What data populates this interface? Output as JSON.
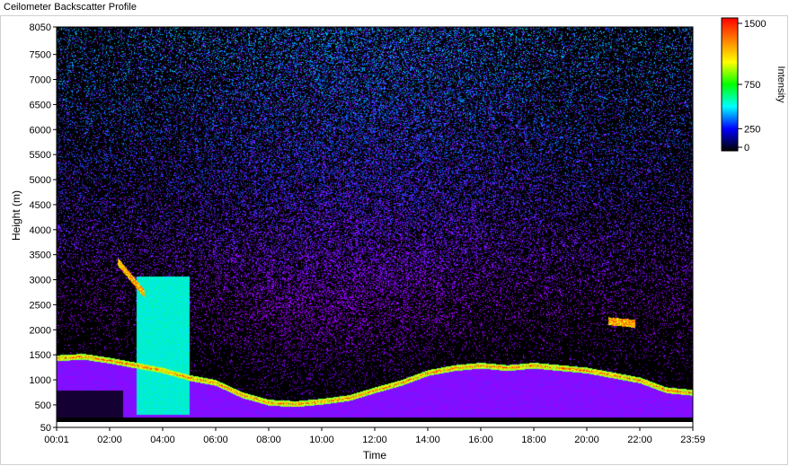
{
  "window": {
    "title": "Ceilometer Backscatter Profile"
  },
  "chart_data": {
    "type": "heatmap",
    "title": "",
    "xlabel": "Time",
    "ylabel": "Height (m)",
    "xlim": [
      "00:01",
      "23:59"
    ],
    "ylim": [
      50,
      8050
    ],
    "x_ticks": [
      "00:01",
      "02:00",
      "04:00",
      "06:00",
      "08:00",
      "10:00",
      "12:00",
      "14:00",
      "16:00",
      "18:00",
      "20:00",
      "22:00",
      "23:59"
    ],
    "y_ticks": [
      50,
      500,
      1000,
      1500,
      2000,
      2500,
      3000,
      3500,
      4000,
      4500,
      5000,
      5500,
      6000,
      6500,
      7000,
      7500,
      8050
    ],
    "colorbar": {
      "label": "Intensity",
      "ticks": [
        0,
        250,
        750,
        1500
      ],
      "range": [
        0,
        1500
      ],
      "colors": [
        "#000000",
        "#0000ff",
        "#00ffff",
        "#00ff00",
        "#ffff00",
        "#ff8000",
        "#ff0000"
      ]
    },
    "features": [
      {
        "name": "boundary layer / aerosol layer top",
        "time_hours": [
          0,
          1,
          2,
          3,
          4,
          5,
          6,
          7,
          8,
          9,
          10,
          11,
          12,
          13,
          14,
          15,
          16,
          17,
          18,
          19,
          20,
          21,
          22,
          23,
          24
        ],
        "height_m": [
          1350,
          1380,
          1300,
          1200,
          1100,
          950,
          850,
          600,
          450,
          420,
          470,
          540,
          700,
          850,
          1050,
          1150,
          1200,
          1150,
          1200,
          1150,
          1100,
          1000,
          900,
          700,
          650
        ]
      },
      {
        "name": "low cloud",
        "time_hours": [
          2.3,
          3.3
        ],
        "height_m": [
          3300,
          2650
        ]
      },
      {
        "name": "cloud",
        "time_hours": [
          20.8,
          21.8
        ],
        "height_m": [
          2100,
          2050
        ]
      }
    ]
  }
}
